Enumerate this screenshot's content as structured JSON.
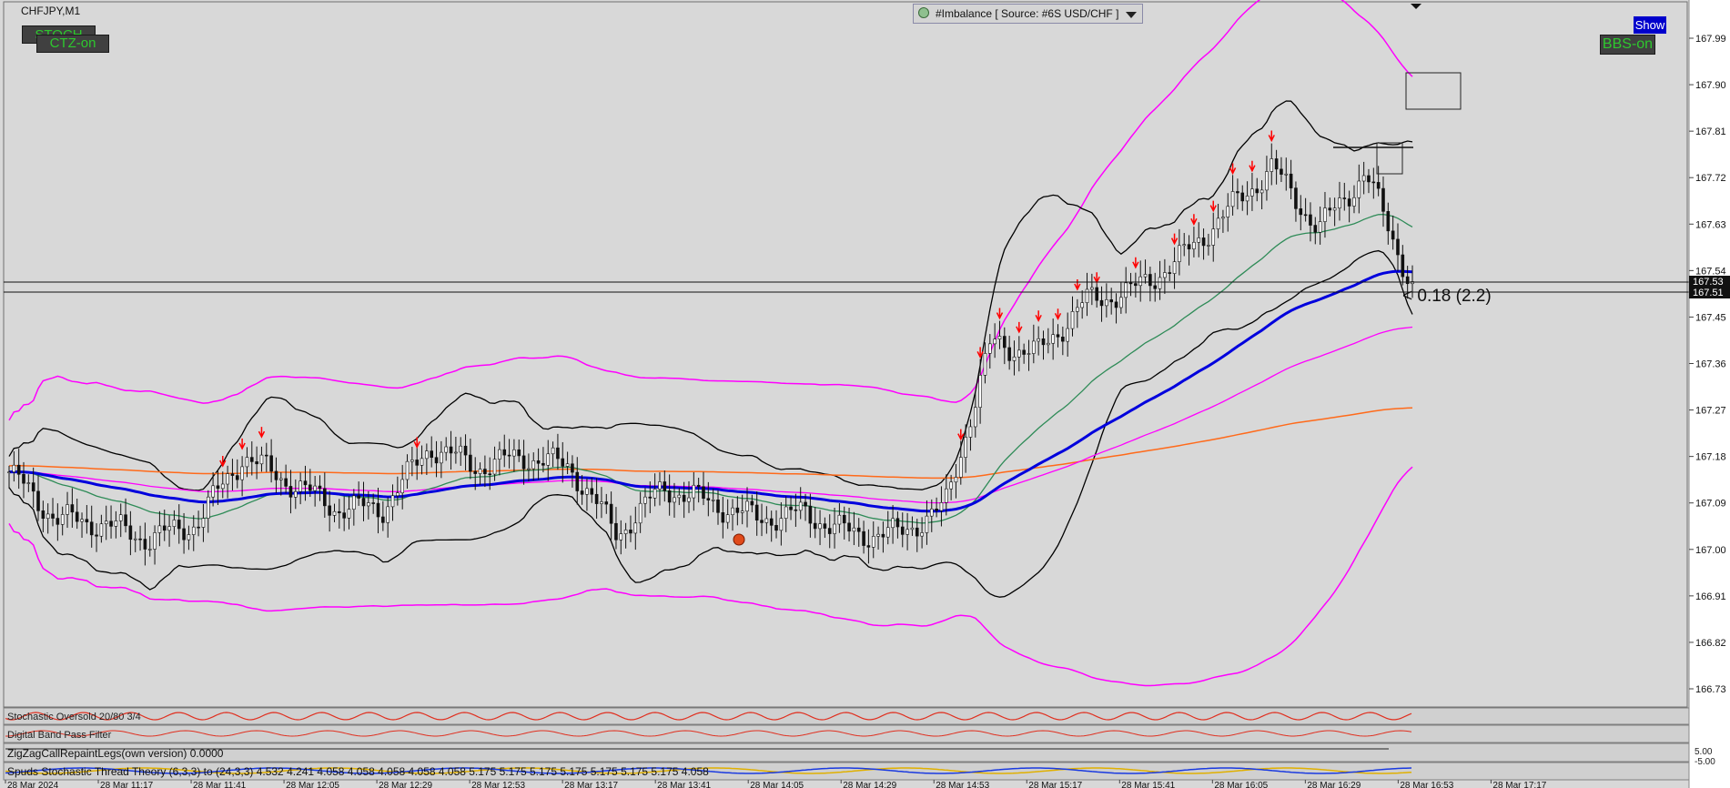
{
  "window": {
    "symbol_label": "CHFJPY,M1"
  },
  "buttons": {
    "stoch": "STOCH",
    "ctz": "CTZ-on",
    "show": "Show",
    "bbs": "BBS-on"
  },
  "indicator_dropdown": {
    "label": "#Imbalance [ Source: #6S USD/CHF ]"
  },
  "price_axis": {
    "ticks": [
      "167.99",
      "167.90",
      "167.81",
      "167.72",
      "167.63",
      "167.54",
      "167.45",
      "167.36",
      "167.27",
      "167.18",
      "167.09",
      "167.00",
      "166.91",
      "166.82",
      "166.73"
    ],
    "current_price_labels": [
      "167.53",
      "167.51"
    ]
  },
  "annotation": {
    "spread_text": "< 0.18 (2.2)"
  },
  "subpanels": [
    {
      "name": "Stochastic",
      "label": "Stochastic Oversold 20/80 3/4"
    },
    {
      "name": "Digital Band Pass Filter",
      "label": "Digital Band Pass Filter"
    },
    {
      "name": "ZigZag",
      "label": "ZigZagCallRepaintLegs(own version) 0.0000"
    },
    {
      "name": "Spuds",
      "label": "Spuds Stochastic Thread Theory (6,3,3) to (24,3,3) 4.532 4.241 4.058 4.058 4.058 4.058 4.058 5.175 5.175 5.175 5.175 5.175 5.175 5.175 4.058"
    }
  ],
  "subpanel_right_values": [
    "5.00",
    "-5.00"
  ],
  "time_axis": {
    "ticks": [
      "28 Mar 2024",
      "28 Mar 11:17",
      "28 Mar 11:41",
      "28 Mar 12:05",
      "28 Mar 12:29",
      "28 Mar 12:53",
      "28 Mar 13:17",
      "28 Mar 13:41",
      "28 Mar 14:05",
      "28 Mar 14:29",
      "28 Mar 14:53",
      "28 Mar 15:17",
      "28 Mar 15:41",
      "28 Mar 16:05",
      "28 Mar 16:29",
      "28 Mar 16:53",
      "28 Mar 17:17"
    ]
  },
  "colors": {
    "background": "#d8d8d8",
    "axis_bg": "#ffffff",
    "bollinger_outer": "#ff00ff",
    "bollinger_inner": "#000000",
    "ma_blue": "#0000dd",
    "ma_orange": "#ff6a1a",
    "ma_green": "#2e8b57",
    "signal_arrow": "#ff0000",
    "button_text": "#2ec82e",
    "show_button_bg": "#0000cc"
  },
  "chart_data": {
    "type": "candlestick",
    "symbol": "CHFJPY",
    "timeframe": "M1",
    "ylim": [
      166.7,
      168.02
    ],
    "x_categories": [
      "28 Mar 2024",
      "28 Mar 11:17",
      "28 Mar 11:41",
      "28 Mar 12:05",
      "28 Mar 12:29",
      "28 Mar 12:53",
      "28 Mar 13:17",
      "28 Mar 13:41",
      "28 Mar 14:05",
      "28 Mar 14:29",
      "28 Mar 14:53",
      "28 Mar 15:17",
      "28 Mar 15:41",
      "28 Mar 16:05",
      "28 Mar 16:29",
      "28 Mar 16:53",
      "28 Mar 17:17"
    ],
    "close_trace": [
      167.15,
      167.06,
      167.05,
      167.02,
      167.05,
      167.18,
      167.13,
      167.08,
      167.08,
      167.2,
      167.16,
      167.18,
      167.16,
      167.03,
      167.12,
      167.09,
      167.06,
      167.07,
      167.03,
      167.03,
      167.08,
      167.4,
      167.38,
      167.48,
      167.5,
      167.56,
      167.65,
      167.74,
      167.62,
      167.73,
      167.51
    ],
    "bid_line": 167.53,
    "ask_line": 167.51,
    "spread": "0.18 (2.2)",
    "grid": false
  }
}
